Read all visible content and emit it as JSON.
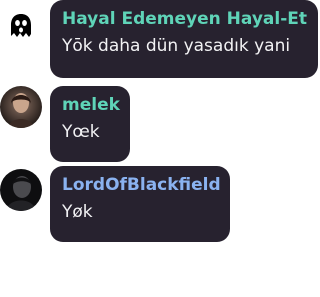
{
  "messages": [
    {
      "author": "Hayal Edemeyen Hayal-Et",
      "author_color": "#5fd4b8",
      "text": "Yōk daha dün yasadık yani",
      "avatar": "ghost-icon"
    },
    {
      "author": "melek",
      "author_color": "#5fd4b8",
      "text": "Yœk",
      "avatar": "user-avatar-photo"
    },
    {
      "author": "LordOfBlackfield",
      "author_color": "#8ab2f0",
      "text": "Yøk",
      "avatar": "user-avatar-photo"
    }
  ],
  "colors": {
    "bubble_bg": "#27222f",
    "message_text": "#f2f2f4"
  }
}
